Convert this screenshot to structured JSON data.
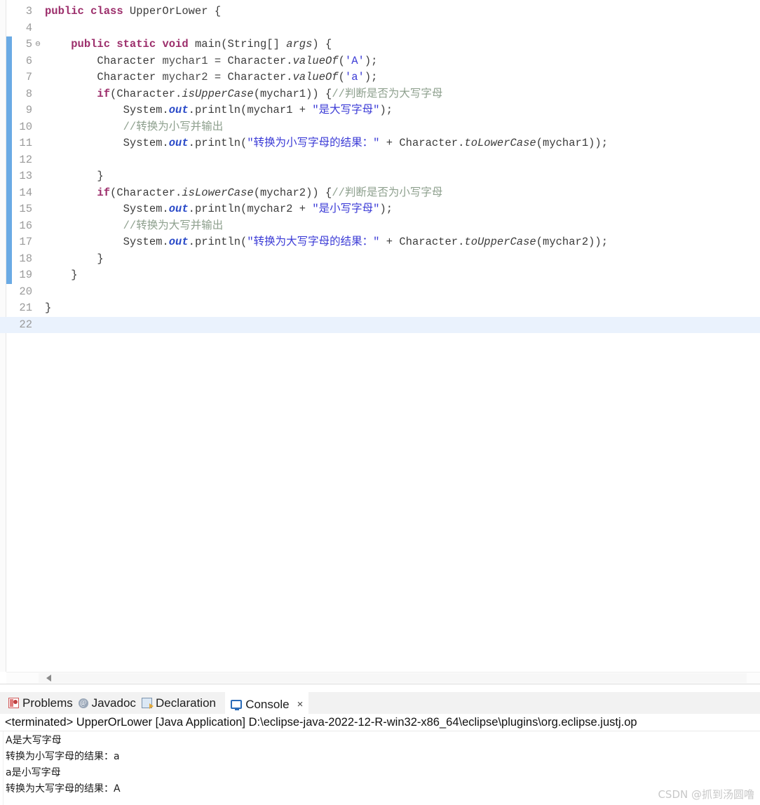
{
  "editor": {
    "top_partial_line": "2",
    "first_visible_line": 3,
    "current_line": 22,
    "change_bar_from_line": 5,
    "change_bar_to_line": 19,
    "lines": [
      {
        "num": "3",
        "fold": "",
        "segments": [
          {
            "cls": "kw",
            "t": "public class "
          },
          {
            "cls": "plain",
            "t": "UpperOrLower {"
          }
        ]
      },
      {
        "num": "4",
        "fold": "",
        "segments": []
      },
      {
        "num": "5",
        "fold": "⊖",
        "segments": [
          {
            "cls": "plain",
            "t": "    "
          },
          {
            "cls": "kw",
            "t": "public static void "
          },
          {
            "cls": "plain",
            "t": "main(String[] "
          },
          {
            "cls": "stat",
            "t": "args"
          },
          {
            "cls": "plain",
            "t": ") {"
          }
        ]
      },
      {
        "num": "6",
        "fold": "",
        "segments": [
          {
            "cls": "plain",
            "t": "        Character "
          },
          {
            "cls": "id",
            "t": "mychar1"
          },
          {
            "cls": "plain",
            "t": " = Character."
          },
          {
            "cls": "stat",
            "t": "valueOf"
          },
          {
            "cls": "plain",
            "t": "("
          },
          {
            "cls": "str",
            "t": "'A'"
          },
          {
            "cls": "plain",
            "t": ");"
          }
        ]
      },
      {
        "num": "7",
        "fold": "",
        "segments": [
          {
            "cls": "plain",
            "t": "        Character "
          },
          {
            "cls": "id",
            "t": "mychar2"
          },
          {
            "cls": "plain",
            "t": " = Character."
          },
          {
            "cls": "stat",
            "t": "valueOf"
          },
          {
            "cls": "plain",
            "t": "("
          },
          {
            "cls": "str",
            "t": "'a'"
          },
          {
            "cls": "plain",
            "t": ");"
          }
        ]
      },
      {
        "num": "8",
        "fold": "",
        "segments": [
          {
            "cls": "plain",
            "t": "        "
          },
          {
            "cls": "kw",
            "t": "if"
          },
          {
            "cls": "plain",
            "t": "(Character."
          },
          {
            "cls": "stat",
            "t": "isUpperCase"
          },
          {
            "cls": "plain",
            "t": "(mychar1)) {"
          },
          {
            "cls": "cmt",
            "t": "//判断是否为大写字母"
          }
        ]
      },
      {
        "num": "9",
        "fold": "",
        "segments": [
          {
            "cls": "plain",
            "t": "            System."
          },
          {
            "cls": "statb",
            "t": "out"
          },
          {
            "cls": "plain",
            "t": ".println(mychar1 + "
          },
          {
            "cls": "str",
            "t": "\"是大写字母\""
          },
          {
            "cls": "plain",
            "t": ");"
          }
        ]
      },
      {
        "num": "10",
        "fold": "",
        "segments": [
          {
            "cls": "plain",
            "t": "            "
          },
          {
            "cls": "cmt",
            "t": "//转换为小写并输出"
          }
        ]
      },
      {
        "num": "11",
        "fold": "",
        "segments": [
          {
            "cls": "plain",
            "t": "            System."
          },
          {
            "cls": "statb",
            "t": "out"
          },
          {
            "cls": "plain",
            "t": ".println("
          },
          {
            "cls": "str",
            "t": "\"转换为小写字母的结果：\""
          },
          {
            "cls": "plain",
            "t": " + Character."
          },
          {
            "cls": "stat",
            "t": "toLowerCase"
          },
          {
            "cls": "plain",
            "t": "(mychar1));"
          }
        ]
      },
      {
        "num": "12",
        "fold": "",
        "segments": []
      },
      {
        "num": "13",
        "fold": "",
        "segments": [
          {
            "cls": "plain",
            "t": "        }"
          }
        ]
      },
      {
        "num": "14",
        "fold": "",
        "segments": [
          {
            "cls": "plain",
            "t": "        "
          },
          {
            "cls": "kw",
            "t": "if"
          },
          {
            "cls": "plain",
            "t": "(Character."
          },
          {
            "cls": "stat",
            "t": "isLowerCase"
          },
          {
            "cls": "plain",
            "t": "(mychar2)) {"
          },
          {
            "cls": "cmt",
            "t": "//判断是否为小写字母"
          }
        ]
      },
      {
        "num": "15",
        "fold": "",
        "segments": [
          {
            "cls": "plain",
            "t": "            System."
          },
          {
            "cls": "statb",
            "t": "out"
          },
          {
            "cls": "plain",
            "t": ".println(mychar2 + "
          },
          {
            "cls": "str",
            "t": "\"是小写字母\""
          },
          {
            "cls": "plain",
            "t": ");"
          }
        ]
      },
      {
        "num": "16",
        "fold": "",
        "segments": [
          {
            "cls": "plain",
            "t": "            "
          },
          {
            "cls": "cmt",
            "t": "//转换为大写并输出"
          }
        ]
      },
      {
        "num": "17",
        "fold": "",
        "segments": [
          {
            "cls": "plain",
            "t": "            System."
          },
          {
            "cls": "statb",
            "t": "out"
          },
          {
            "cls": "plain",
            "t": ".println("
          },
          {
            "cls": "str",
            "t": "\"转换为大写字母的结果：\""
          },
          {
            "cls": "plain",
            "t": " + Character."
          },
          {
            "cls": "stat",
            "t": "toUpperCase"
          },
          {
            "cls": "plain",
            "t": "(mychar2));"
          }
        ]
      },
      {
        "num": "18",
        "fold": "",
        "segments": [
          {
            "cls": "plain",
            "t": "        }"
          }
        ]
      },
      {
        "num": "19",
        "fold": "",
        "segments": [
          {
            "cls": "plain",
            "t": "    }"
          }
        ]
      },
      {
        "num": "20",
        "fold": "",
        "segments": []
      },
      {
        "num": "21",
        "fold": "",
        "segments": [
          {
            "cls": "plain",
            "t": "}"
          }
        ]
      },
      {
        "num": "22",
        "fold": "",
        "segments": []
      }
    ]
  },
  "bottom_panel": {
    "tabs": [
      {
        "label": "Problems",
        "icon": "problems-icon",
        "active": false,
        "closable": false
      },
      {
        "label": "Javadoc",
        "icon": "javadoc-icon",
        "active": false,
        "closable": false
      },
      {
        "label": "Declaration",
        "icon": "declaration-icon",
        "active": false,
        "closable": false
      },
      {
        "label": "Console",
        "icon": "console-icon",
        "active": true,
        "closable": true
      }
    ],
    "close_glyph": "×",
    "javadoc_glyph": "@",
    "console": {
      "header": "<terminated> UpperOrLower [Java Application] D:\\eclipse-java-2022-12-R-win32-x86_64\\eclipse\\plugins\\org.eclipse.justj.op",
      "output_lines": [
        "A是大写字母",
        "转换为小写字母的结果：a",
        "a是小写字母",
        "转换为大写字母的结果：A"
      ]
    }
  },
  "watermark": {
    "text": "CSDN @抓到汤圆噜"
  },
  "colors": {
    "keyword": "#9c2e6b",
    "string": "#3b3bd6",
    "comment": "#8ea08e",
    "static_field": "#2a4ac8",
    "change_bar": "#6aaae4",
    "current_line": "#eaf2fd",
    "tab_bar_bg": "#f2f2f2"
  }
}
